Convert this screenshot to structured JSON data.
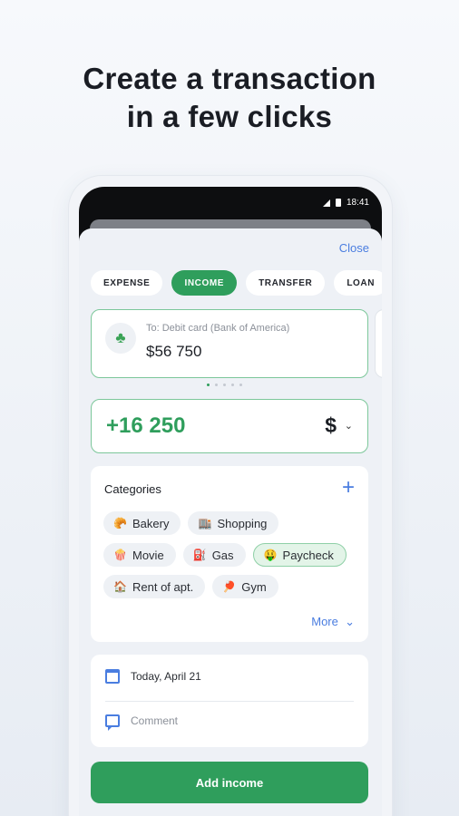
{
  "headline": {
    "line1": "Create a transaction",
    "line2": "in a few clicks"
  },
  "status_bar": {
    "time": "18:41"
  },
  "sheet": {
    "close_label": "Close"
  },
  "tabs": [
    {
      "label": "EXPENSE",
      "active": false
    },
    {
      "label": "INCOME",
      "active": true
    },
    {
      "label": "TRANSFER",
      "active": false
    },
    {
      "label": "LOAN",
      "active": false
    }
  ],
  "account": {
    "icon": "clover-icon",
    "label": "To: Debit card (Bank of America)",
    "balance": "$56 750"
  },
  "amount": {
    "value": "+16 250",
    "currency": "$"
  },
  "categories": {
    "title": "Categories",
    "more_label": "More",
    "items": [
      {
        "label": "Bakery",
        "icon": "bakery-icon",
        "glyph": "🥐",
        "selected": false
      },
      {
        "label": "Shopping",
        "icon": "shopping-icon",
        "glyph": "🏬",
        "selected": false
      },
      {
        "label": "Movie",
        "icon": "popcorn-icon",
        "glyph": "🍿",
        "selected": false
      },
      {
        "label": "Gas",
        "icon": "fuel-icon",
        "glyph": "⛽",
        "selected": false
      },
      {
        "label": "Paycheck",
        "icon": "money-face-icon",
        "glyph": "🤑",
        "selected": true
      },
      {
        "label": "Rent of apt.",
        "icon": "house-icon",
        "glyph": "🏠",
        "selected": false
      },
      {
        "label": "Gym",
        "icon": "ping-pong-icon",
        "glyph": "🏓",
        "selected": false
      }
    ]
  },
  "details": {
    "date": "Today, April 21",
    "comment_placeholder": "Comment"
  },
  "action": {
    "label": "Add income"
  },
  "colors": {
    "accent_green": "#2f9e5c",
    "link_blue": "#4a7de0"
  }
}
